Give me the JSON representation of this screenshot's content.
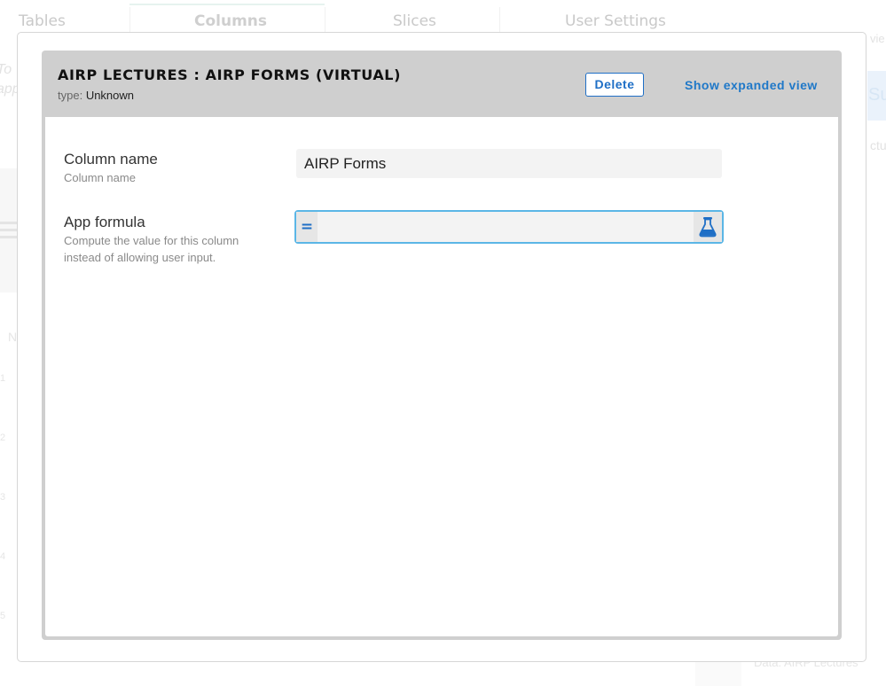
{
  "background": {
    "tabs": [
      "Tables",
      "Columns",
      "Slices",
      "User Settings"
    ],
    "left_texts": [
      "To",
      "app"
    ],
    "row_numbers": [
      "N",
      "1",
      "2",
      "3",
      "4",
      "5"
    ],
    "right_texts": [
      "vie",
      "Su",
      "ctu"
    ],
    "bottom_text": "Data: AIRP  Lectures"
  },
  "dialog": {
    "title": "AIRP LECTURES : AIRP FORMS (VIRTUAL)",
    "type_label": "type:",
    "type_value": "Unknown",
    "delete_label": "Delete",
    "expand_label": "Show expanded view"
  },
  "fields": {
    "column_name": {
      "label": "Column name",
      "help": "Column name",
      "value": "AIRP Forms"
    },
    "app_formula": {
      "label": "App formula",
      "help": "Compute the value for this column instead of allowing user input.",
      "prefix": "=",
      "value": "",
      "icon": "flask-icon"
    }
  },
  "colors": {
    "accent": "#1f6fc6",
    "focus_border": "#5bb6e6",
    "header_bg": "#cfcfcf"
  }
}
